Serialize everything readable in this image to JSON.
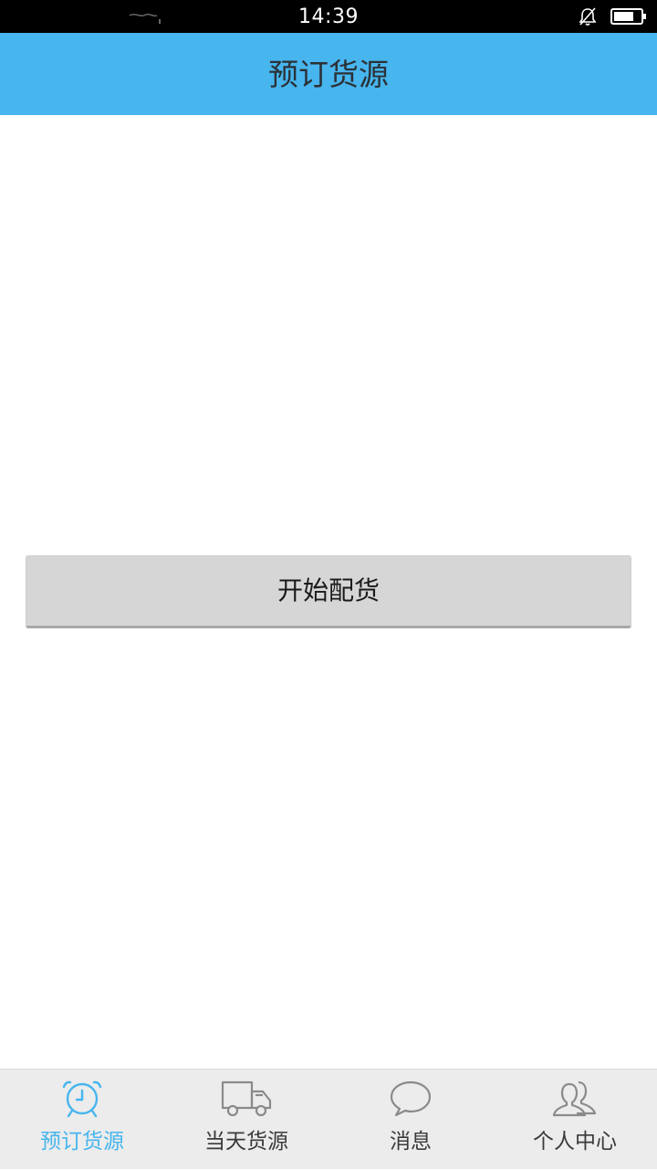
{
  "status_bar": {
    "time": "14:39"
  },
  "header": {
    "title": "预订货源"
  },
  "main": {
    "start_button_label": "开始配货"
  },
  "tab_bar": {
    "active_index": 0,
    "tabs": [
      {
        "label": "预订货源",
        "icon": "alarm-clock-icon"
      },
      {
        "label": "当天货源",
        "icon": "truck-icon"
      },
      {
        "label": "消息",
        "icon": "chat-bubble-icon"
      },
      {
        "label": "个人中心",
        "icon": "users-icon"
      }
    ]
  },
  "colors": {
    "accent": "#47b5ee",
    "status_bar": "#000000",
    "tab_bar_bg": "#ececec",
    "button_bg": "#d6d6d6",
    "icon_inactive": "#8a8a8a"
  }
}
